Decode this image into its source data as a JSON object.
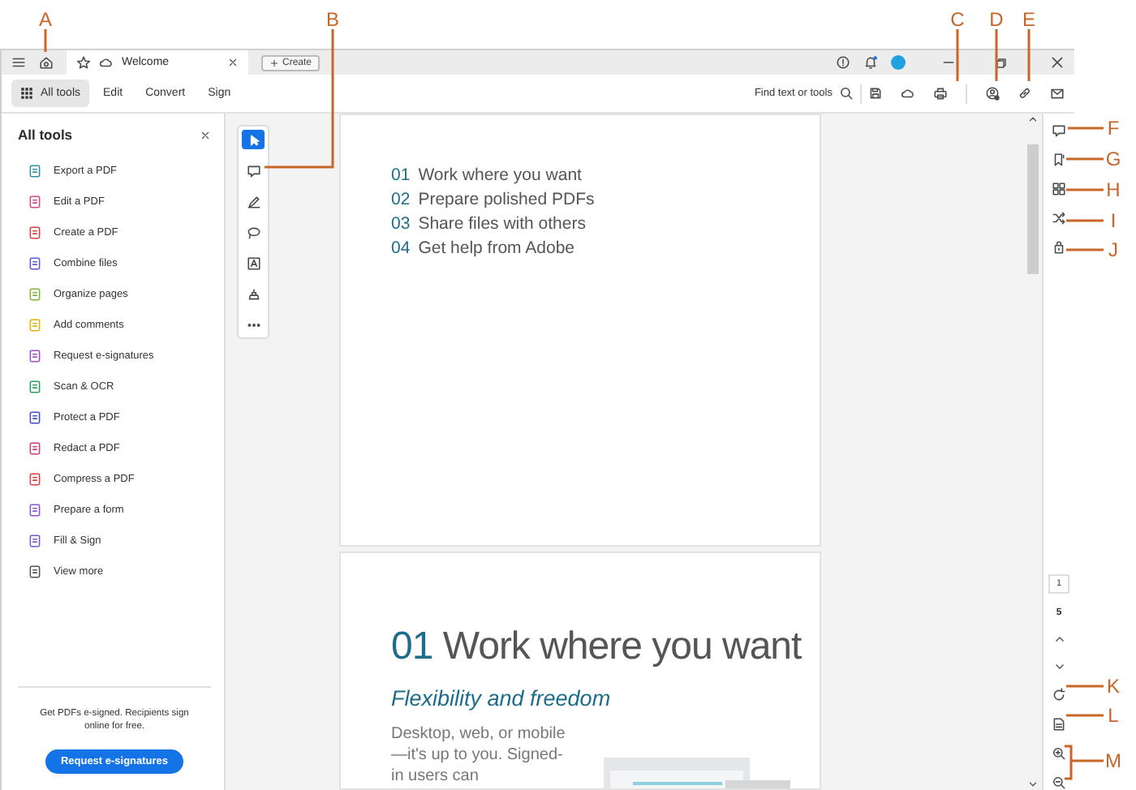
{
  "callouts": [
    {
      "label": "A"
    },
    {
      "label": "B"
    },
    {
      "label": "C"
    },
    {
      "label": "D"
    },
    {
      "label": "E"
    },
    {
      "label": "F"
    },
    {
      "label": "G"
    },
    {
      "label": "H"
    },
    {
      "label": "I"
    },
    {
      "label": "J"
    },
    {
      "label": "K"
    },
    {
      "label": "L"
    },
    {
      "label": "M"
    }
  ],
  "title_bar": {
    "tab": {
      "title": "Welcome"
    },
    "create_button": "Create"
  },
  "toolbar": {
    "tabs": [
      {
        "label": "All tools",
        "selected": true
      },
      {
        "label": "Edit",
        "selected": false
      },
      {
        "label": "Convert",
        "selected": false
      },
      {
        "label": "Sign",
        "selected": false
      }
    ],
    "search": "Find text or tools"
  },
  "tools_panel": {
    "title": "All tools",
    "items": [
      {
        "label": "Export a PDF",
        "color": "#2f8fa6"
      },
      {
        "label": "Edit a PDF",
        "color": "#d9468a"
      },
      {
        "label": "Create a PDF",
        "color": "#d94040"
      },
      {
        "label": "Combine files",
        "color": "#5a5ad6"
      },
      {
        "label": "Organize pages",
        "color": "#7db83a"
      },
      {
        "label": "Add comments",
        "color": "#e0b400"
      },
      {
        "label": "Request e-signatures",
        "color": "#9b4fc9"
      },
      {
        "label": "Scan & OCR",
        "color": "#2d9d5a"
      },
      {
        "label": "Protect a PDF",
        "color": "#3f51c9"
      },
      {
        "label": "Redact a PDF",
        "color": "#c93f7a"
      },
      {
        "label": "Compress a PDF",
        "color": "#d9403f"
      },
      {
        "label": "Prepare a form",
        "color": "#8a55c9"
      },
      {
        "label": "Fill & Sign",
        "color": "#7a5ac9"
      },
      {
        "label": "View more",
        "color": "#555555"
      }
    ],
    "promo": "Get PDFs e-signed. Recipients sign online for free.",
    "promo_button": "Request e-signatures"
  },
  "quick_tools": [
    {
      "kind": "select",
      "selected": true
    },
    {
      "kind": "comment",
      "selected": false
    },
    {
      "kind": "draw",
      "selected": false
    },
    {
      "kind": "lasso",
      "selected": false
    },
    {
      "kind": "textbox",
      "selected": false
    },
    {
      "kind": "stamp",
      "selected": false
    },
    {
      "kind": "more",
      "selected": false
    }
  ],
  "document": {
    "contents": [
      {
        "number": "01",
        "text": "Work where you want"
      },
      {
        "number": "02",
        "text": "Prepare polished PDFs"
      },
      {
        "number": "03",
        "text": "Share files with others"
      },
      {
        "number": "04",
        "text": "Get help from Adobe"
      }
    ],
    "section": {
      "number": "01",
      "title": "Work where you want",
      "subtitle": "Flexibility and freedom",
      "body": "Desktop, web, or mobile—it's up to you. Signed-in users can"
    }
  },
  "page_nav": {
    "current": "1",
    "total": "5"
  }
}
